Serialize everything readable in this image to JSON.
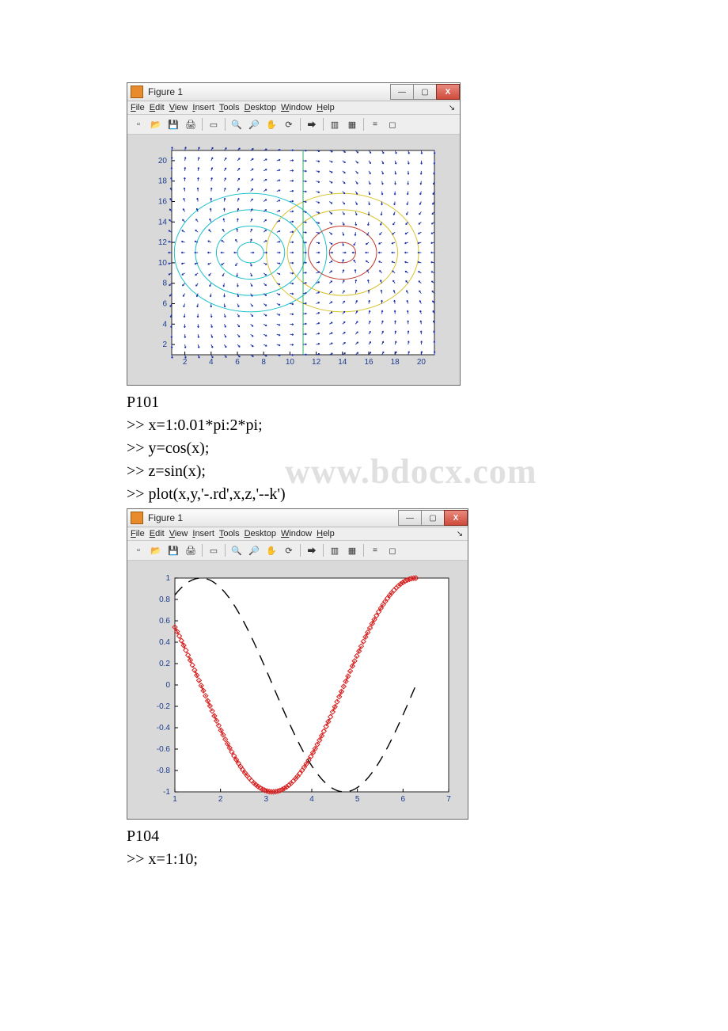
{
  "watermark": "www.bdocx.com",
  "section1": {
    "label": "P101"
  },
  "section2": {
    "label": "P104"
  },
  "code": {
    "l1": ">> x=1:0.01*pi:2*pi;",
    "l2": ">> y=cos(x);",
    "l3": ">> z=sin(x);",
    "l4": ">> plot(x,y,'-.rd',x,z,'--k')",
    "l5": ">> x=1:10;"
  },
  "figure1": {
    "title": "Figure 1",
    "menus": {
      "file": "File",
      "edit": "Edit",
      "view": "View",
      "insert": "Insert",
      "tools": "Tools",
      "desktop": "Desktop",
      "window": "Window",
      "help": "Help"
    },
    "winbuttons": {
      "min": "—",
      "max": "▢",
      "close": "X"
    },
    "xticks": [
      "2",
      "4",
      "6",
      "8",
      "10",
      "12",
      "14",
      "16",
      "18",
      "20"
    ],
    "yticks": [
      "2",
      "4",
      "6",
      "8",
      "10",
      "12",
      "14",
      "16",
      "18",
      "20"
    ]
  },
  "figure2": {
    "title": "Figure 1",
    "menus": {
      "file": "File",
      "edit": "Edit",
      "view": "View",
      "insert": "Insert",
      "tools": "Tools",
      "desktop": "Desktop",
      "window": "Window",
      "help": "Help"
    },
    "winbuttons": {
      "min": "—",
      "max": "▢",
      "close": "X"
    },
    "xticks": [
      "1",
      "2",
      "3",
      "4",
      "5",
      "6",
      "7"
    ],
    "yticks": [
      "-1",
      "-0.8",
      "-0.6",
      "-0.4",
      "-0.2",
      "0",
      "0.2",
      "0.4",
      "0.6",
      "0.8",
      "1"
    ]
  },
  "chart_data": [
    {
      "type": "quiver+contour",
      "title": "",
      "xlim": [
        1,
        21
      ],
      "ylim": [
        1,
        21
      ],
      "xticks": [
        2,
        4,
        6,
        8,
        10,
        12,
        14,
        16,
        18,
        20
      ],
      "yticks": [
        2,
        4,
        6,
        8,
        10,
        12,
        14,
        16,
        18,
        20
      ],
      "contours": [
        {
          "color": "#19c1c9",
          "center": [
            7,
            11
          ],
          "radii": [
            1.0,
            2.6,
            4.2,
            5.8
          ]
        },
        {
          "color": "#d8c22a",
          "center": [
            14,
            11
          ],
          "radii": [
            4.2,
            5.8
          ]
        },
        {
          "color": "#c0392b",
          "center": [
            14,
            11
          ],
          "radii": [
            1.0,
            2.6
          ]
        },
        {
          "color": "#27ae60",
          "type": "vline",
          "x": 11
        }
      ],
      "quiver": {
        "grid_x": [
          1,
          2,
          3,
          4,
          5,
          6,
          7,
          8,
          9,
          10,
          11,
          12,
          13,
          14,
          15,
          16,
          17,
          18,
          19,
          20,
          21
        ],
        "grid_y": [
          1,
          2,
          3,
          4,
          5,
          6,
          7,
          8,
          9,
          10,
          11,
          12,
          13,
          14,
          15,
          16,
          17,
          18,
          19,
          20,
          21
        ],
        "field": "dipole-like gradient around centers (7,11) and (14,11)",
        "arrow_color": "#1a2ea8"
      }
    },
    {
      "type": "line",
      "title": "",
      "xlim": [
        1,
        7
      ],
      "ylim": [
        -1,
        1
      ],
      "xticks": [
        1,
        2,
        3,
        4,
        5,
        6,
        7
      ],
      "yticks": [
        -1,
        -0.8,
        -0.6,
        -0.4,
        -0.2,
        0,
        0.2,
        0.4,
        0.6,
        0.8,
        1
      ],
      "x": [
        1.0,
        1.31,
        1.63,
        1.94,
        2.26,
        2.57,
        2.88,
        3.2,
        3.51,
        3.83,
        4.14,
        4.46,
        4.77,
        5.09,
        5.4,
        5.71,
        6.03,
        6.28
      ],
      "series": [
        {
          "name": "cos(x)",
          "style": "-.rd",
          "color": "#d81e1e",
          "values": [
            0.54,
            0.25,
            -0.06,
            -0.36,
            -0.63,
            -0.84,
            -0.97,
            -1.0,
            -0.93,
            -0.77,
            -0.54,
            -0.25,
            0.06,
            0.36,
            0.63,
            0.84,
            0.97,
            1.0
          ]
        },
        {
          "name": "sin(x)",
          "style": "--k",
          "color": "#000000",
          "values": [
            0.84,
            0.97,
            1.0,
            0.93,
            0.77,
            0.54,
            0.25,
            -0.06,
            -0.36,
            -0.63,
            -0.84,
            -0.97,
            -1.0,
            -0.93,
            -0.77,
            -0.54,
            -0.25,
            0.0
          ]
        }
      ]
    }
  ]
}
